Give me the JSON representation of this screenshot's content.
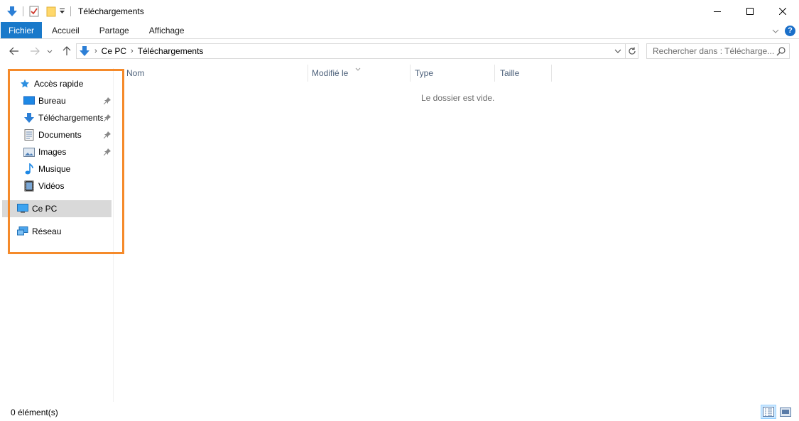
{
  "window": {
    "title": "Téléchargements",
    "controls": [
      "minimize",
      "maximize",
      "close"
    ]
  },
  "ribbon": {
    "tabs": [
      {
        "label": "Fichier",
        "active": true
      },
      {
        "label": "Accueil"
      },
      {
        "label": "Partage"
      },
      {
        "label": "Affichage"
      }
    ],
    "help_label": "?"
  },
  "addressbar": {
    "breadcrumbs": [
      "Ce PC",
      "Téléchargements"
    ],
    "search_placeholder": "Rechercher dans : Télécharge..."
  },
  "navpane": {
    "quick_access_label": "Accès rapide",
    "items": [
      {
        "label": "Bureau",
        "icon": "desktop-icon",
        "pinned": true
      },
      {
        "label": "Téléchargements",
        "icon": "downloads-icon",
        "pinned": true
      },
      {
        "label": "Documents",
        "icon": "documents-icon",
        "pinned": true
      },
      {
        "label": "Images",
        "icon": "pictures-icon",
        "pinned": true
      },
      {
        "label": "Musique",
        "icon": "music-icon",
        "pinned": false
      },
      {
        "label": "Vidéos",
        "icon": "videos-icon",
        "pinned": false
      }
    ],
    "this_pc_label": "Ce PC",
    "network_label": "Réseau"
  },
  "filelist": {
    "columns": [
      "Nom",
      "Modifié le",
      "Type",
      "Taille"
    ],
    "empty_message": "Le dossier est vide."
  },
  "statusbar": {
    "item_count": "0 élément(s)"
  },
  "colors": {
    "accent": "#1979ca",
    "highlight_box": "#f58a2a",
    "selection": "#d9d9d9"
  }
}
